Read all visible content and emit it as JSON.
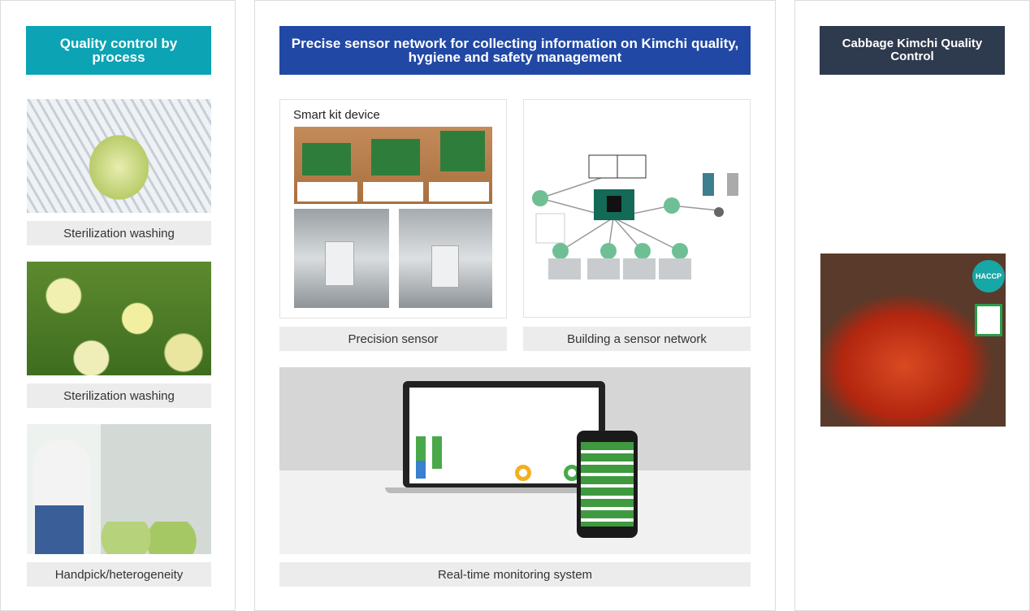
{
  "colors": {
    "teal": "#0ca3b4",
    "blue": "#2148a4",
    "navy": "#2e3a4e",
    "caption_bg": "#ececec"
  },
  "left": {
    "title": "Quality control by process",
    "items": [
      {
        "caption": "Sterilization washing"
      },
      {
        "caption": "Sterilization washing"
      },
      {
        "caption": "Handpick/heterogeneity"
      }
    ]
  },
  "middle": {
    "title": "Precise sensor network for collecting information on Kimchi quality, hygiene and safety management",
    "smart_kit_title": "Smart kit device",
    "captions": {
      "sensor": "Precision sensor",
      "network": "Building a sensor network",
      "monitoring": "Real-time monitoring system"
    }
  },
  "right": {
    "title": "Cabbage Kimchi Quality Control",
    "logo_text": "HACCP"
  }
}
